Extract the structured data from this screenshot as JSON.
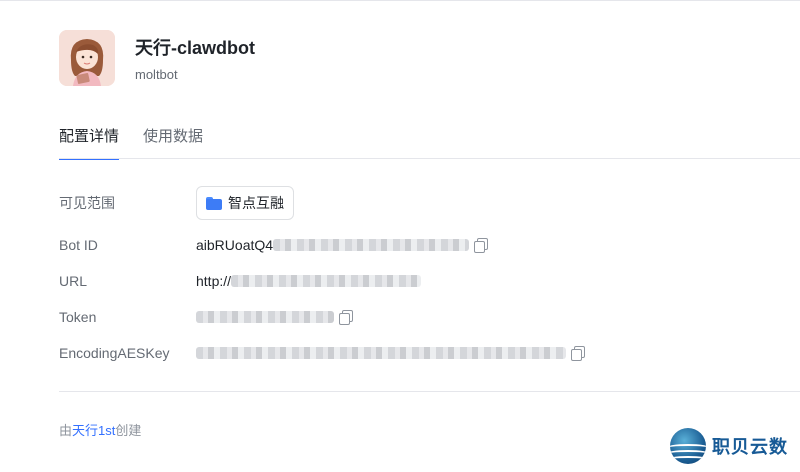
{
  "app": {
    "name": "天行-clawdbot",
    "subtitle": "moltbot"
  },
  "tabs": [
    {
      "label": "配置详情",
      "active": true
    },
    {
      "label": "使用数据",
      "active": false
    }
  ],
  "fields": {
    "scope_label": "可见范围",
    "scope_value": "智点互融",
    "bot_id_label": "Bot ID",
    "bot_id_value": "aibRUoatQ4",
    "url_label": "URL",
    "url_value": "http://",
    "token_label": "Token",
    "token_value": "",
    "aes_label": "EncodingAESKey",
    "aes_value": ""
  },
  "footer": {
    "prefix": "由",
    "creator": "天行1st",
    "suffix": "创建"
  },
  "watermark": {
    "text": "职贝云数"
  },
  "colors": {
    "accent": "#3370ff",
    "label": "#646a73",
    "text": "#1f2329",
    "folder": "#3d7cf6"
  }
}
